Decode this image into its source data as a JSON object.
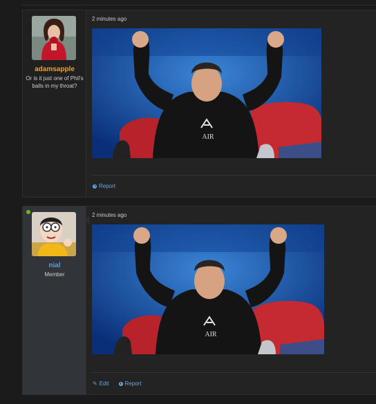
{
  "posts": [
    {
      "username": "adamsapple",
      "user_title": "Or is it just one of Phil's balls in my throat?",
      "timestamp": "2 minutes ago",
      "actions": {
        "report": "Report"
      },
      "username_color": "#e0a23a"
    },
    {
      "username": "nial",
      "user_title": "Member",
      "timestamp": "2 minutes ago",
      "online": true,
      "actions": {
        "edit": "Edit",
        "report": "Report"
      },
      "username_color": "#5d9ad8"
    }
  ],
  "colors": {
    "link": "#6aa7e0",
    "online": "#5fbf1f",
    "background": "#1b1b1b"
  }
}
